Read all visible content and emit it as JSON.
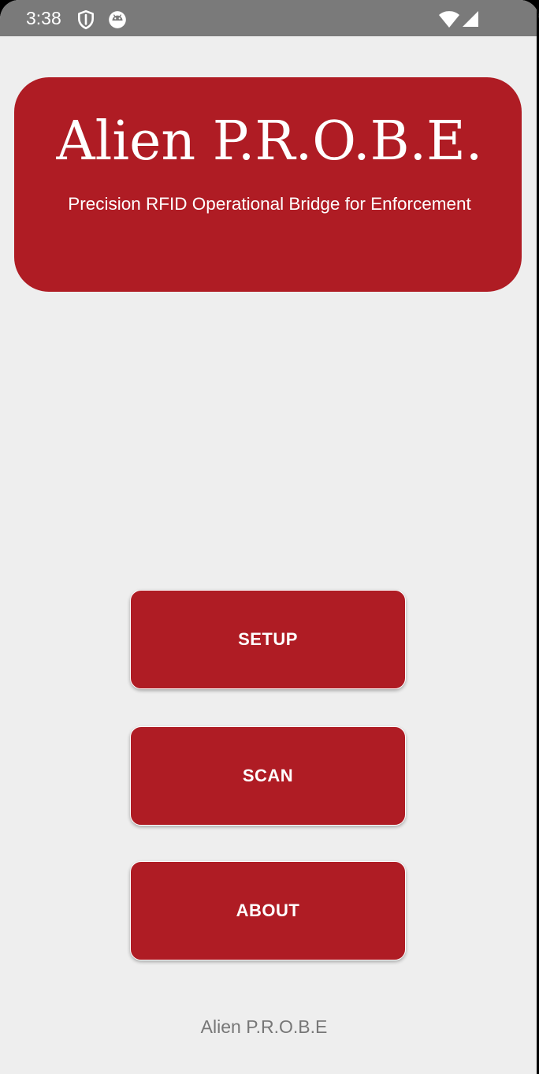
{
  "status_bar": {
    "time": "3:38",
    "icons": [
      "shield-icon",
      "android-icon",
      "wifi-icon",
      "signal-icon"
    ]
  },
  "header": {
    "title": "Alien P.R.O.B.E.",
    "subtitle": "Precision RFID Operational Bridge for Enforcement"
  },
  "buttons": {
    "setup": "SETUP",
    "scan": "SCAN",
    "about": "ABOUT"
  },
  "footer": {
    "text": "Alien P.R.O.B.E"
  },
  "colors": {
    "brand_red": "#af1c24",
    "background": "#eeeeee",
    "status_bar": "#7a7a7a",
    "footer_text": "#777777"
  }
}
